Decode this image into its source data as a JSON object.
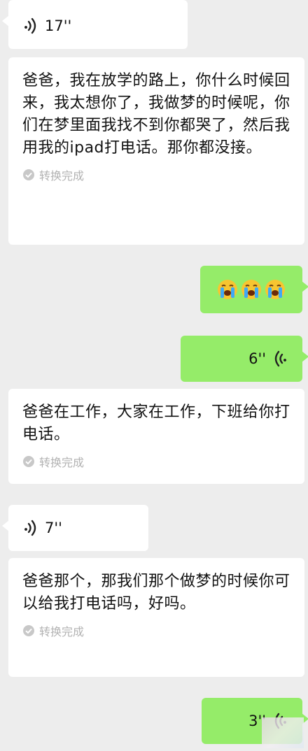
{
  "messages": [
    {
      "type": "voice",
      "side": "left",
      "duration": "17''"
    },
    {
      "type": "transcript",
      "text": "爸爸，我在放学的路上，你什么时候回来，我太想你了，我做梦的时候呢，你们在梦里面我找不到你都哭了，然后我用我的ipad打电话。那你都没接。",
      "status": "转换完成"
    },
    {
      "type": "emoji",
      "side": "right",
      "emoji_name": "loudly-crying-face",
      "count": 3
    },
    {
      "type": "voice",
      "side": "right",
      "duration": "6''"
    },
    {
      "type": "transcript",
      "text": "爸爸在工作，大家在工作，下班给你打电话。",
      "status": "转换完成"
    },
    {
      "type": "voice",
      "side": "left",
      "duration": "7''"
    },
    {
      "type": "transcript",
      "text": "爸爸那个，那我们那个做梦的时候你可以给我打电话吗，好吗。",
      "status": "转换完成"
    },
    {
      "type": "voice",
      "side": "right",
      "duration": "3''"
    }
  ],
  "colors": {
    "background": "#ededed",
    "bubble_self": "#95ec69",
    "bubble_other": "#ffffff",
    "status_text": "#b2b2b2"
  }
}
